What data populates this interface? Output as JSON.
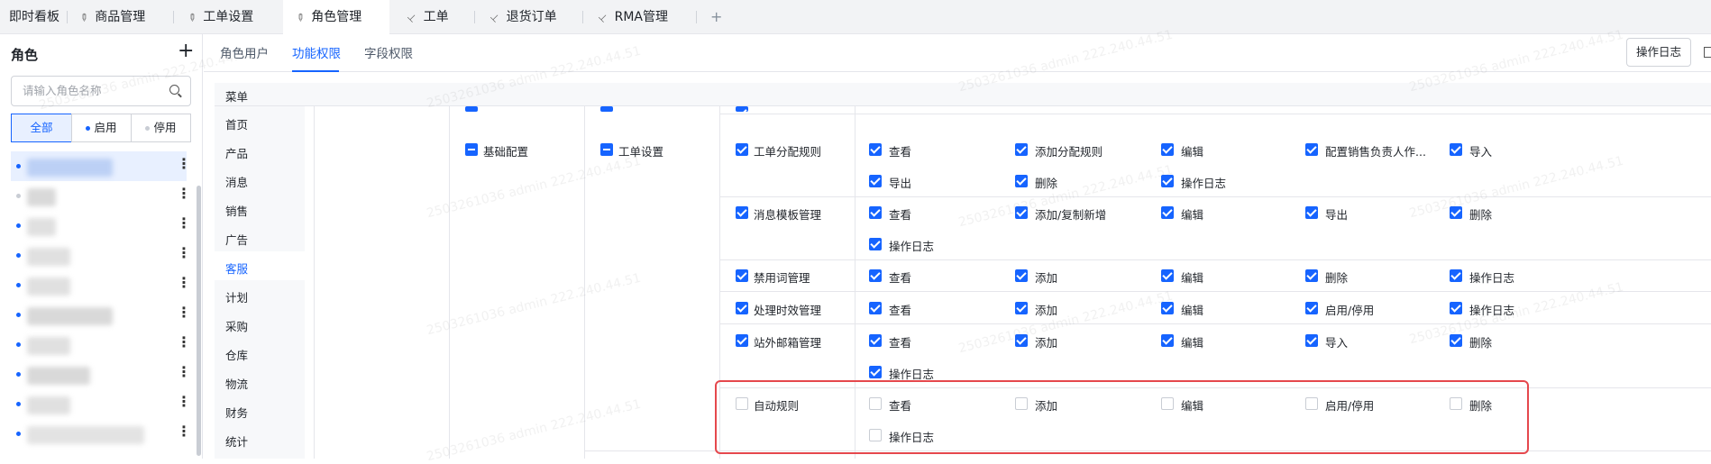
{
  "tabs": [
    {
      "label": "即时看板",
      "pinned": false,
      "active": false
    },
    {
      "label": "商品管理",
      "pinned": true,
      "active": false
    },
    {
      "label": "工单设置",
      "pinned": true,
      "active": false
    },
    {
      "label": "角色管理",
      "pinned": true,
      "active": true
    },
    {
      "label": "工单",
      "pinned": true,
      "active": false
    },
    {
      "label": "退货订单",
      "pinned": true,
      "active": false
    },
    {
      "label": "RMA管理",
      "pinned": true,
      "active": false
    }
  ],
  "tab_add": "+",
  "left": {
    "title": "角色",
    "add_icon": "+",
    "search_placeholder": "请输入角色名称",
    "filters": [
      {
        "label": "全部",
        "active": true
      },
      {
        "label": "启用",
        "dot_color": "#1664ff"
      },
      {
        "label": "停用",
        "dot_color": "#c9cdd4"
      }
    ],
    "more_icon": "⋮"
  },
  "subtabs": [
    {
      "label": "角色用户",
      "active": false
    },
    {
      "label": "功能权限",
      "active": true
    },
    {
      "label": "字段权限",
      "active": false
    }
  ],
  "log_button": "操作日志",
  "menu": {
    "header": "菜单",
    "items": [
      "首页",
      "产品",
      "消息",
      "销售",
      "广告",
      "客服",
      "计划",
      "采购",
      "仓库",
      "物流",
      "财务",
      "统计"
    ],
    "active": "客服"
  },
  "tree": {
    "level1": {
      "label": "基础配置",
      "state": "partial"
    },
    "level2": {
      "label": "工单设置",
      "state": "partial"
    },
    "modules": [
      {
        "label": "工单分配规则",
        "checked": true,
        "perms": [
          "查看",
          "添加分配规则",
          "编辑",
          "配置销售负责人作...",
          "导入",
          "导出",
          "删除",
          "操作日志"
        ]
      },
      {
        "label": "消息模板管理",
        "checked": true,
        "perms": [
          "查看",
          "添加/复制新增",
          "编辑",
          "导出",
          "删除",
          "操作日志"
        ]
      },
      {
        "label": "禁用词管理",
        "checked": true,
        "perms": [
          "查看",
          "添加",
          "编辑",
          "删除",
          "操作日志"
        ]
      },
      {
        "label": "处理时效管理",
        "checked": true,
        "perms": [
          "查看",
          "添加",
          "编辑",
          "启用/停用",
          "操作日志"
        ]
      },
      {
        "label": "站外邮箱管理",
        "checked": true,
        "perms": [
          "查看",
          "添加",
          "编辑",
          "导入",
          "删除",
          "操作日志"
        ]
      },
      {
        "label": "自动规则",
        "checked": false,
        "perms": [
          "查看",
          "添加",
          "编辑",
          "启用/停用",
          "删除",
          "操作日志"
        ]
      }
    ]
  },
  "watermark": "2503261036 admin 222.240.44.51",
  "colors": {
    "primary": "#1664ff",
    "highlight_border": "#e5484d"
  }
}
